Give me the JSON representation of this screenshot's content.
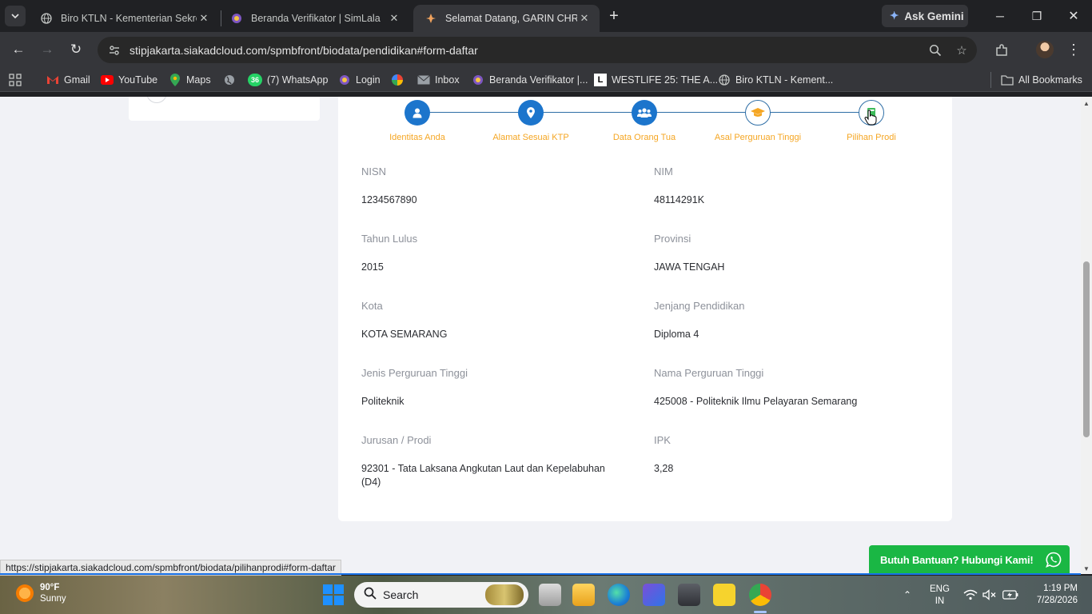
{
  "browser": {
    "tabs": [
      {
        "title": "Biro KTLN - Kementerian Sekret",
        "active": false
      },
      {
        "title": "Beranda Verifikator | SimLala",
        "active": false
      },
      {
        "title": "Selamat Datang, GARIN CHRIST",
        "active": true
      }
    ],
    "gemini_label": "Ask Gemini",
    "url": "stipjakarta.siakadcloud.com/spmbfront/biodata/pendidikan#form-daftar",
    "bookmarks": [
      "Gmail",
      "YouTube",
      "Maps",
      "(7) WhatsApp",
      "Login",
      "Inbox",
      "Beranda Verifikator |...",
      "WESTLIFE 25: THE A...",
      "Biro KTLN - Kement..."
    ],
    "whatsapp_badge": "36",
    "all_bookmarks": "All Bookmarks"
  },
  "wizard": {
    "steps": [
      {
        "label": "Identitas Anda",
        "icon": "user-icon"
      },
      {
        "label": "Alamat Sesuai KTP",
        "icon": "map-pin-icon"
      },
      {
        "label": "Data Orang Tua",
        "icon": "users-icon"
      },
      {
        "label": "Asal Perguruan Tinggi",
        "icon": "graduation-cap-icon"
      },
      {
        "label": "Pilihan Prodi",
        "icon": "book-icon"
      }
    ]
  },
  "form": {
    "nisn_label": "NISN",
    "nisn": "1234567890",
    "nim_label": "NIM",
    "nim": "48114291K",
    "tahun_label": "Tahun Lulus",
    "tahun": "2015",
    "provinsi_label": "Provinsi",
    "provinsi": "JAWA TENGAH",
    "kota_label": "Kota",
    "kota": "KOTA SEMARANG",
    "jenjang_label": "Jenjang Pendidikan",
    "jenjang": "Diploma 4",
    "jenis_label": "Jenis Perguruan Tinggi",
    "jenis": "Politeknik",
    "nama_pt_label": "Nama Perguruan Tinggi",
    "nama_pt": "425008 - Politeknik Ilmu Pelayaran Semarang",
    "jurusan_label": "Jurusan / Prodi",
    "jurusan": "92301 - Tata Laksana Angkutan Laut dan Kepelabuhan (D4)",
    "ipk_label": "IPK",
    "ipk": "3,28"
  },
  "help_button": "Butuh Bantuan? Hubungi Kami!",
  "status_url": "https://stipjakarta.siakadcloud.com/spmbfront/biodata/pilihanprodi#form-daftar",
  "taskbar": {
    "weather_temp": "90°F",
    "weather_desc": "Sunny",
    "search_placeholder": "Search",
    "lang1": "ENG",
    "lang2": "IN",
    "time": "1:19 PM",
    "date": "7/28/2026"
  },
  "colors": {
    "accent": "#1c75cc",
    "step_label": "#f5a623",
    "help_green": "#1ab744"
  }
}
